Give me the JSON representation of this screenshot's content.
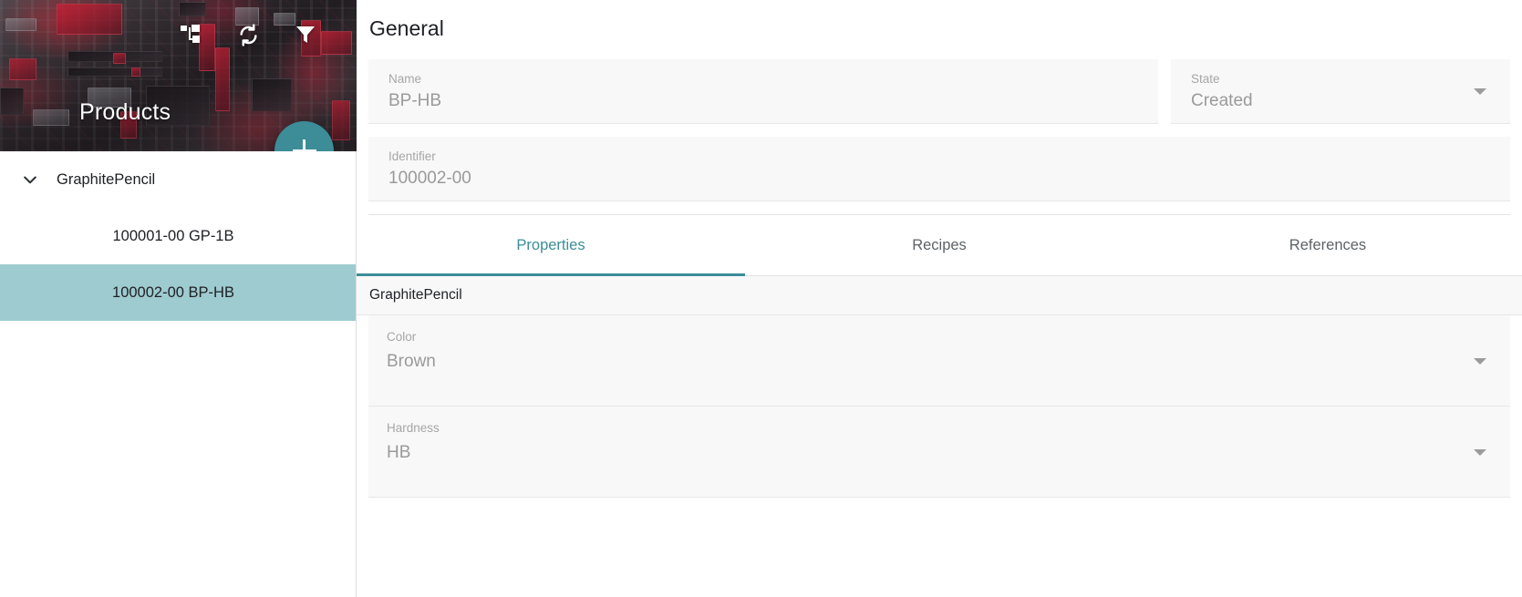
{
  "sidebar": {
    "title": "Products",
    "icons": [
      {
        "name": "hierarchy-icon",
        "label": "Hierarchy"
      },
      {
        "name": "refresh-icon",
        "label": "Refresh"
      },
      {
        "name": "filter-icon",
        "label": "Filter"
      }
    ],
    "add_button_label": "+",
    "tree": {
      "group_label": "GraphitePencil",
      "expanded": true,
      "items": [
        {
          "label": "100001-00 GP-1B",
          "selected": false
        },
        {
          "label": "100002-00 BP-HB",
          "selected": true
        }
      ]
    }
  },
  "main": {
    "title": "General",
    "fields": {
      "name": {
        "label": "Name",
        "value": "BP-HB"
      },
      "state": {
        "label": "State",
        "value": "Created"
      },
      "identifier": {
        "label": "Identifier",
        "value": "100002-00"
      }
    },
    "tabs": [
      {
        "label": "Properties",
        "active": true
      },
      {
        "label": "Recipes",
        "active": false
      },
      {
        "label": "References",
        "active": false
      }
    ],
    "properties": {
      "group_label": "GraphitePencil",
      "fields": [
        {
          "label": "Color",
          "value": "Brown"
        },
        {
          "label": "Hardness",
          "value": "HB"
        }
      ]
    }
  },
  "colors": {
    "accent_teal": "#3c8d97",
    "selected_row": "#9ecbd0",
    "field_bg": "#f8f8f8",
    "label_grey": "#a6a6a6",
    "value_grey": "#9a9a9a"
  }
}
